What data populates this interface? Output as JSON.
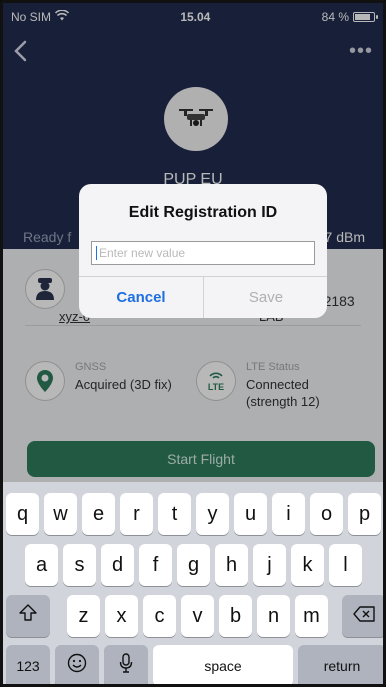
{
  "status_bar": {
    "carrier": "No SIM",
    "time": "15.04",
    "battery": "84 %"
  },
  "header": {
    "drone_name": "PUP EU",
    "status_left": "Ready f",
    "signal": "67 dBm"
  },
  "info": {
    "registration": {
      "value": "xyz-0"
    },
    "operator": {
      "label_partial": "r",
      "number": "352183",
      "lab": "LAB"
    },
    "gnss": {
      "label": "GNSS",
      "value": "Acquired (3D fix)"
    },
    "lte": {
      "label": "LTE Status",
      "value_line1": "Connected",
      "value_line2": "(strength 12)",
      "badge": "LTE"
    }
  },
  "start_button": {
    "label": "Start Flight"
  },
  "dialog": {
    "title": "Edit Registration ID",
    "placeholder": "Enter new value",
    "cancel": "Cancel",
    "save": "Save"
  },
  "keyboard": {
    "row1": [
      "q",
      "w",
      "e",
      "r",
      "t",
      "y",
      "u",
      "i",
      "o",
      "p"
    ],
    "row2": [
      "a",
      "s",
      "d",
      "f",
      "g",
      "h",
      "j",
      "k",
      "l"
    ],
    "row3": [
      "z",
      "x",
      "c",
      "v",
      "b",
      "n",
      "m"
    ],
    "numbers_key": "123",
    "space_key": "space",
    "return_key": "return"
  },
  "colors": {
    "header_bg": "#222d4f",
    "accent_green": "#2f7c5e",
    "ios_blue": "#1e6fe0"
  },
  "icons": [
    "wifi-icon",
    "battery-icon",
    "back-chevron-icon",
    "more-icon",
    "drone-icon",
    "operator-icon",
    "gnss-pin-icon",
    "lte-icon",
    "shift-icon",
    "backspace-icon",
    "emoji-icon",
    "mic-icon"
  ]
}
